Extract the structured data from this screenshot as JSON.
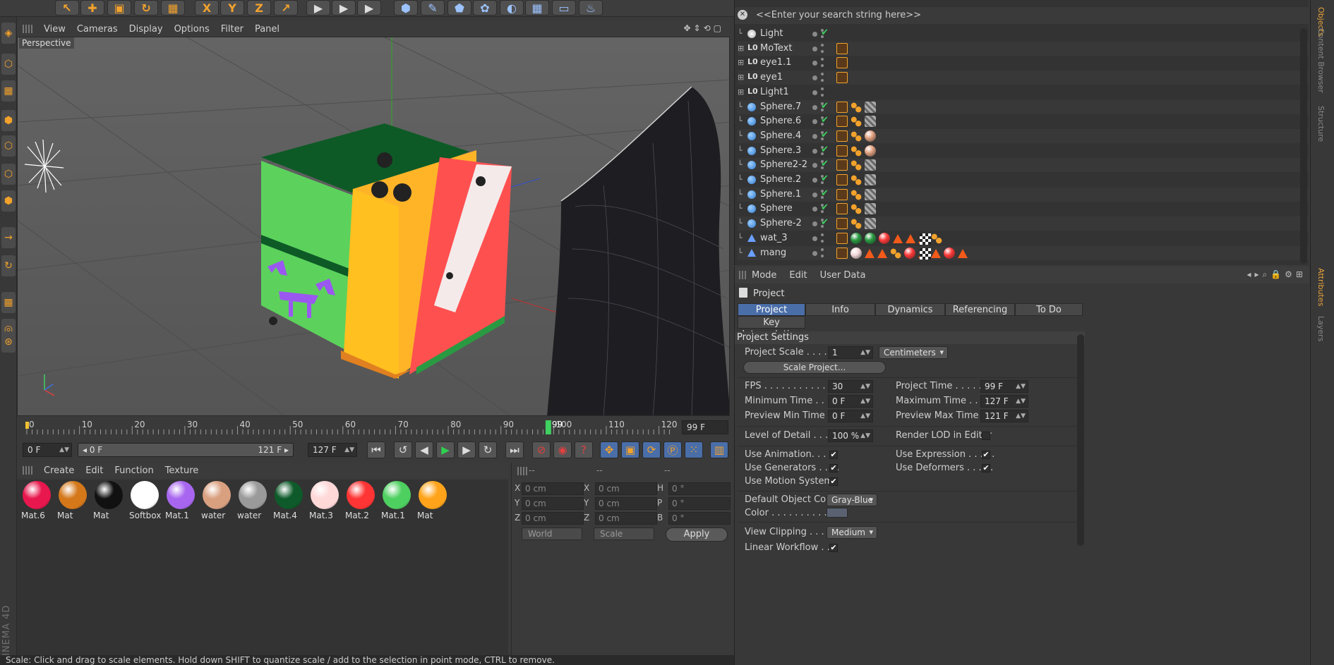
{
  "colors": {
    "accent_orange": "#f2a22c",
    "selection_blue": "#4a6ea8",
    "check_green": "#3fd060"
  },
  "toolbar": {
    "icons": [
      "live-selection-icon",
      "move-icon",
      "scale-icon",
      "rotate-icon",
      "recent-tools-icon",
      "x-axis-icon",
      "y-axis-icon",
      "z-axis-icon",
      "coordinate-system-icon",
      "render-view-icon",
      "render-picture-viewer-icon",
      "render-settings-icon",
      "cube-icon",
      "pen-icon",
      "subdivision-icon",
      "array-icon",
      "deformer-icon",
      "floor-icon",
      "camera-icon",
      "light-icon"
    ],
    "axis_x": "X",
    "axis_y": "Y",
    "axis_z": "Z"
  },
  "viewport": {
    "menu": [
      "View",
      "Cameras",
      "Display",
      "Options",
      "Filter",
      "Panel"
    ],
    "label": "Perspective",
    "nav_icons": "✥⇕⟲▢"
  },
  "timeline": {
    "ticks": [
      "0",
      "10",
      "20",
      "30",
      "40",
      "50",
      "60",
      "70",
      "80",
      "90",
      "100",
      "110",
      "120"
    ],
    "current_frame": 99,
    "current_label": "99",
    "max_frame": 127,
    "end_field": "99 F"
  },
  "transport": {
    "start_field": "0 F",
    "range_start": "◂ 0 F",
    "range_end": "121 F ▸",
    "end_field": "127 F"
  },
  "materials": {
    "menu": [
      "Create",
      "Edit",
      "Function",
      "Texture"
    ],
    "items": [
      {
        "label": "Mat.6",
        "color": "#e8174d"
      },
      {
        "label": "Mat",
        "color": "#d4781a"
      },
      {
        "label": "Mat",
        "color": "#111111"
      },
      {
        "label": "Softbox",
        "color": "#ffffff"
      },
      {
        "label": "Mat.1",
        "color": "#a866f0"
      },
      {
        "label": "water",
        "color": "#d9a080"
      },
      {
        "label": "water",
        "color": "#9a9a9a"
      },
      {
        "label": "Mat.4",
        "color": "#0f5a2a"
      },
      {
        "label": "Mat.3",
        "color": "#ffd8d8"
      },
      {
        "label": "Mat.2",
        "color": "#ff3434"
      },
      {
        "label": "Mat.1",
        "color": "#4ed060"
      },
      {
        "label": "Mat",
        "color": "#ffa41a"
      }
    ]
  },
  "coords": {
    "headers": [
      "--",
      "--",
      "--"
    ],
    "rows": [
      {
        "a": "X",
        "av": "0 cm",
        "b": "X",
        "bv": "0 cm",
        "c": "H",
        "cv": "0 °"
      },
      {
        "a": "Y",
        "av": "0 cm",
        "b": "Y",
        "bv": "0 cm",
        "c": "P",
        "cv": "0 °"
      },
      {
        "a": "Z",
        "av": "0 cm",
        "b": "Z",
        "bv": "0 cm",
        "c": "B",
        "cv": "0 °"
      }
    ],
    "world": "World",
    "scale": "Scale",
    "apply": "Apply"
  },
  "status": "Scale: Click and drag to scale elements. Hold down SHIFT to quantize scale / add to the selection in point mode, CTRL to remove.",
  "brand": "CINEMA 4D",
  "objects": {
    "search": "<<Enter your search string here>>",
    "rows": [
      {
        "name": "Light",
        "icon": "light",
        "check": "✔",
        "tags": []
      },
      {
        "name": "MoText",
        "icon": "null",
        "check": "",
        "tags": [
          "phong"
        ]
      },
      {
        "name": "eye1.1",
        "icon": "null",
        "check": "",
        "tags": [
          "phong"
        ]
      },
      {
        "name": "eye1",
        "icon": "null",
        "check": "",
        "tags": [
          "phong"
        ]
      },
      {
        "name": "Light1",
        "icon": "null",
        "check": "",
        "tags": []
      },
      {
        "name": "Sphere.7",
        "icon": "sphere",
        "check": "✔",
        "tags": [
          "phong",
          "dots2",
          "tex"
        ]
      },
      {
        "name": "Sphere.6",
        "icon": "sphere",
        "check": "✔",
        "tags": [
          "phong",
          "dots2",
          "tex"
        ]
      },
      {
        "name": "Sphere.4",
        "icon": "sphere",
        "check": "✔",
        "tags": [
          "phong",
          "dots2",
          "ball-peach"
        ]
      },
      {
        "name": "Sphere.3",
        "icon": "sphere",
        "check": "✔",
        "tags": [
          "phong",
          "dots2",
          "ball-peach"
        ]
      },
      {
        "name": "Sphere2-2",
        "icon": "sphere",
        "check": "✔",
        "tags": [
          "phong",
          "dots2",
          "tex"
        ]
      },
      {
        "name": "Sphere.2",
        "icon": "sphere",
        "check": "✔",
        "tags": [
          "phong",
          "dots2",
          "tex"
        ]
      },
      {
        "name": "Sphere.1",
        "icon": "sphere",
        "check": "✔",
        "tags": [
          "phong",
          "dots2",
          "tex"
        ]
      },
      {
        "name": "Sphere",
        "icon": "sphere",
        "check": "✔",
        "tags": [
          "phong",
          "dots2",
          "tex"
        ]
      },
      {
        "name": "Sphere-2",
        "icon": "sphere",
        "check": "✔",
        "tags": [
          "phong",
          "dots2",
          "tex"
        ]
      },
      {
        "name": "wat_3",
        "icon": "poly",
        "check": "",
        "tags": [
          "phong",
          "ball-green",
          "ball-green",
          "ball-red",
          "tri",
          "tri",
          "tri",
          "chk",
          "dots2"
        ]
      },
      {
        "name": "mang",
        "icon": "poly",
        "check": "",
        "tags": [
          "phong",
          "ball-white",
          "tri",
          "tri",
          "chk",
          "dots2",
          "ball-red",
          "tri",
          "tri",
          "ball-red",
          "tri"
        ]
      }
    ]
  },
  "right_tabs": [
    "Objects",
    "Content Browser",
    "Structure",
    "Attributes",
    "Layers"
  ],
  "attributes": {
    "menu": [
      "Mode",
      "Edit",
      "User Data"
    ],
    "title": "Project",
    "tabs": [
      "Project Settings",
      "Info",
      "Dynamics",
      "Referencing",
      "To Do"
    ],
    "tab2": "Key Interpolation",
    "section": "Project Settings",
    "project_scale_label": "Project Scale . . . . . .",
    "project_scale_value": "1",
    "project_scale_unit": "Centimeters",
    "scale_project_btn": "Scale Project...",
    "fps_label": "FPS . . . . . . . . . . . . . .",
    "fps_value": "30",
    "project_time_label": "Project Time . . . . . . .",
    "project_time_value": "99 F",
    "min_time_label": "Minimum Time . . . .",
    "min_time_value": "0 F",
    "max_time_label": "Maximum Time . . . . .",
    "max_time_value": "127 F",
    "prev_min_label": "Preview Min Time . .",
    "prev_min_value": "0 F",
    "prev_max_label": "Preview Max Time . . .",
    "prev_max_value": "121 F",
    "lod_label": "Level of Detail . . . . .",
    "lod_value": "100 %",
    "render_lod_label": "Render LOD in Editor",
    "use_animation_label": "Use Animation. . . . .",
    "use_expression_label": "Use Expression . . . . .",
    "use_generators_label": "Use Generators . . . .",
    "use_deformers_label": "Use Deformers . . . . .",
    "use_motion_label": "Use Motion System",
    "default_color_label": "Default Object Color",
    "default_color_value": "Gray-Blue",
    "color_label": "Color . . . . . . . . . .",
    "view_clipping_label": "View Clipping . . . . .",
    "view_clipping_value": "Medium",
    "linear_workflow_label": "Linear Workflow . . .",
    "check": "✔"
  }
}
